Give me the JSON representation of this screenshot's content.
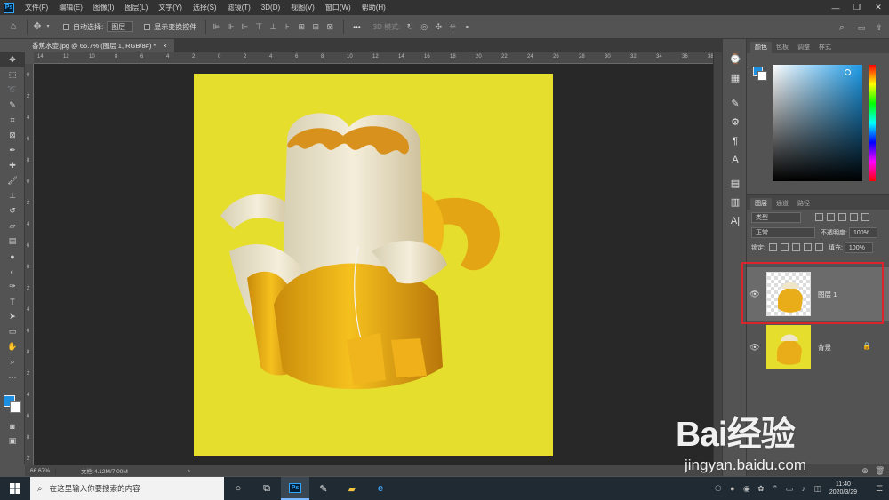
{
  "menubar": {
    "logo": "Ps",
    "items": [
      "文件(F)",
      "编辑(E)",
      "图像(I)",
      "图层(L)",
      "文字(Y)",
      "选择(S)",
      "滤镜(T)",
      "3D(D)",
      "视图(V)",
      "窗口(W)",
      "帮助(H)"
    ]
  },
  "options": {
    "auto_select_label": "自动选择:",
    "auto_select_value": "图层",
    "show_transform_label": "显示变换控件",
    "mode_3d_label": "3D 模式:",
    "more_label": "•••"
  },
  "document": {
    "tab_title": "香蕉水壶.jpg @ 66.7% (图层 1, RGB/8#) *",
    "close_glyph": "×",
    "background_color": "#e6de2c"
  },
  "ruler": {
    "top_ticks": [
      "14",
      "12",
      "10",
      "8",
      "6",
      "4",
      "2",
      "0",
      "2",
      "4",
      "6",
      "8",
      "10",
      "12",
      "14",
      "16",
      "18",
      "20",
      "22",
      "24",
      "26",
      "28",
      "30",
      "32",
      "34",
      "36",
      "38"
    ],
    "left_ticks": [
      "0",
      "2",
      "4",
      "6",
      "8",
      "0",
      "2",
      "4",
      "6",
      "8",
      "2",
      "4",
      "6",
      "8",
      "2",
      "4",
      "6",
      "8",
      "2"
    ]
  },
  "status": {
    "zoom": "66.67%",
    "doc_info": "文档:4.12M/7.00M",
    "arrow": "›"
  },
  "color_panel": {
    "tabs": [
      "颜色",
      "色板",
      "调整",
      "样式"
    ],
    "fg_color": "#1d8fe0",
    "bg_color": "#ffffff"
  },
  "layers_panel": {
    "tabs": [
      "图层",
      "通道",
      "路径"
    ],
    "filter_label": "类型",
    "blend_mode": "正常",
    "opacity_label": "不透明度:",
    "opacity_value": "100%",
    "lock_label": "锁定:",
    "fill_label": "填充:",
    "fill_value": "100%",
    "layers": [
      {
        "name": "图层 1",
        "selected": true
      },
      {
        "name": "背景",
        "locked": true
      }
    ]
  },
  "taskbar": {
    "search_placeholder": "在这里输入你要搜索的内容",
    "time": "11:40",
    "date": "2020/3/29"
  },
  "watermark": {
    "brand": "Bai经验",
    "url": "jingyan.baidu.com"
  }
}
